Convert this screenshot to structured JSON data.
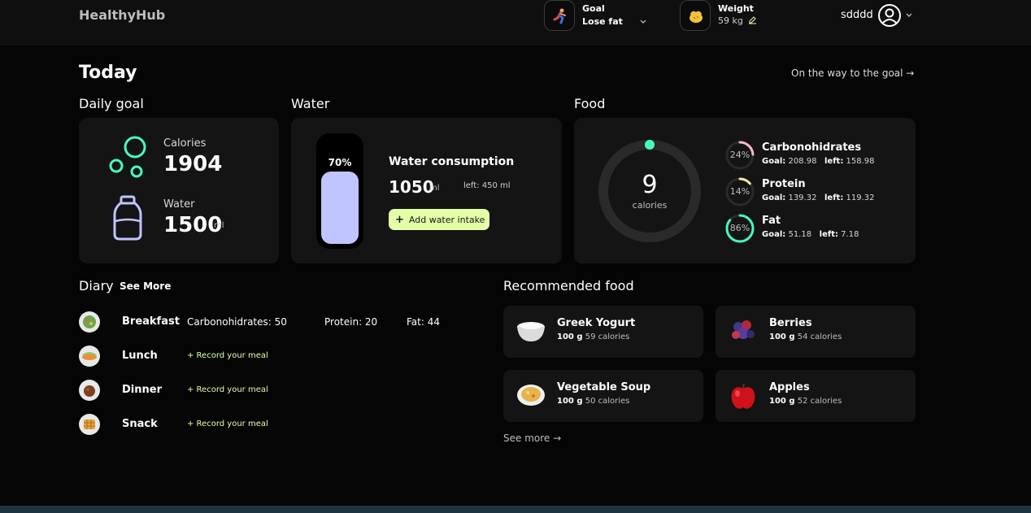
{
  "header": {
    "logo": "HealthyHub",
    "goal": {
      "label": "Goal",
      "value": "Lose fat"
    },
    "weight": {
      "label": "Weight",
      "value": "59 kg"
    },
    "user": {
      "name": "sdddd"
    }
  },
  "today": {
    "title": "Today",
    "goal_link": "On the way to the goal →"
  },
  "daily_goal": {
    "title": "Daily goal",
    "calories_label": "Calories",
    "calories_value": "1904",
    "water_label": "Water",
    "water_value": "1500",
    "water_unit": "ml"
  },
  "water": {
    "title": "Water",
    "percent_label": "70%",
    "percent": 0.7,
    "consumption_title": "Water consumption",
    "amount": "1050",
    "amount_unit": "ml",
    "left_text": "left: 450 ml",
    "add_button": "Add water intake"
  },
  "food": {
    "title": "Food",
    "calories_value": "9",
    "calories_caption": "calories",
    "macros": [
      {
        "name": "Carbonohidrates",
        "percent_label": "24%",
        "percent": 0.24,
        "goal_label": "Goal:",
        "goal": "208.98",
        "left_label": "left:",
        "left": "158.98",
        "color": "#f7b7d6"
      },
      {
        "name": "Protein",
        "percent_label": "14%",
        "percent": 0.14,
        "goal_label": "Goal:",
        "goal": "139.32",
        "left_label": "left:",
        "left": "119.32",
        "color": "#f5e79e"
      },
      {
        "name": "Fat",
        "percent_label": "86%",
        "percent": 0.86,
        "goal_label": "Goal:",
        "goal": "51.18",
        "left_label": "left:",
        "left": "7.18",
        "color": "#45ffbc"
      }
    ]
  },
  "diary": {
    "title": "Diary",
    "see_more": "See More",
    "meals": [
      {
        "name": "Breakfast",
        "carbs": "Carbonohidrates: 50",
        "protein": "Protein: 20",
        "fat": "Fat: 44"
      },
      {
        "name": "Lunch",
        "record": "+ Record your meal"
      },
      {
        "name": "Dinner",
        "record": "+ Record your meal"
      },
      {
        "name": "Snack",
        "record": "+ Record your meal"
      }
    ]
  },
  "recommended": {
    "title": "Recommended food",
    "items": [
      {
        "name": "Greek Yogurt",
        "amount": "100 g",
        "calories": "59 calories",
        "icon": "yogurt-icon"
      },
      {
        "name": "Berries",
        "amount": "100 g",
        "calories": "54 calories",
        "icon": "berries-icon"
      },
      {
        "name": "Vegetable Soup",
        "amount": "100 g",
        "calories": "50 calories",
        "icon": "soup-icon"
      },
      {
        "name": "Apples",
        "amount": "100 g",
        "calories": "52 calories",
        "icon": "apple-icon"
      }
    ],
    "see_more": "See more →"
  },
  "colors": {
    "accent_green": "#45ffbc",
    "accent_lime": "#e3ffa8",
    "water_fill": "#c0c4ff",
    "card_bg": "#141414"
  }
}
